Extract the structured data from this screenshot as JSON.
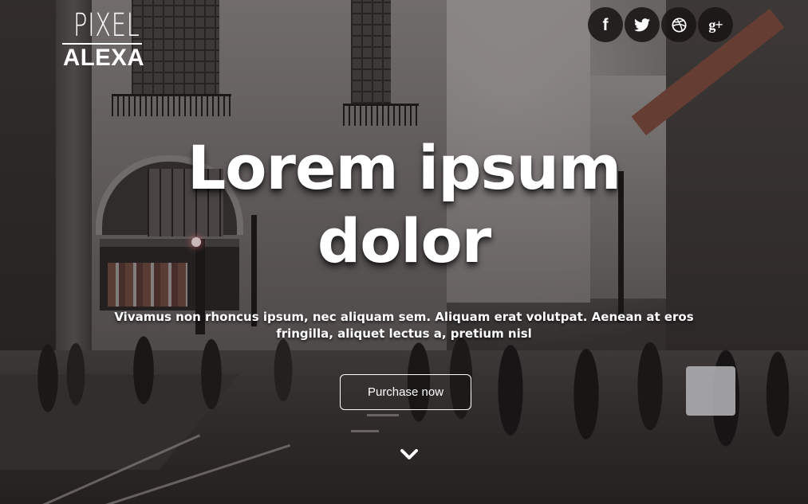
{
  "logo": {
    "line1": "PIXEL",
    "line2": "ALEXA"
  },
  "social": [
    {
      "name": "facebook",
      "icon": "facebook-icon",
      "glyph": "f"
    },
    {
      "name": "twitter",
      "icon": "twitter-icon"
    },
    {
      "name": "dribbble",
      "icon": "dribbble-icon"
    },
    {
      "name": "google-plus",
      "icon": "google-plus-icon",
      "glyph": "g+"
    }
  ],
  "hero": {
    "headline_line1": "Lorem ipsum",
    "headline_line2": "dolor",
    "subtext_line1": "Vivamus non rhoncus ipsum, nec aliquam sem. Aliquam erat volutpat. Aenean at eros",
    "subtext_line2": "fringilla, aliquet lectus a, pretium nisl",
    "cta_label": "Purchase now",
    "scroll_icon": "chevron-down-icon"
  },
  "colors": {
    "text": "#ffffff",
    "social_bg": "#191616"
  }
}
